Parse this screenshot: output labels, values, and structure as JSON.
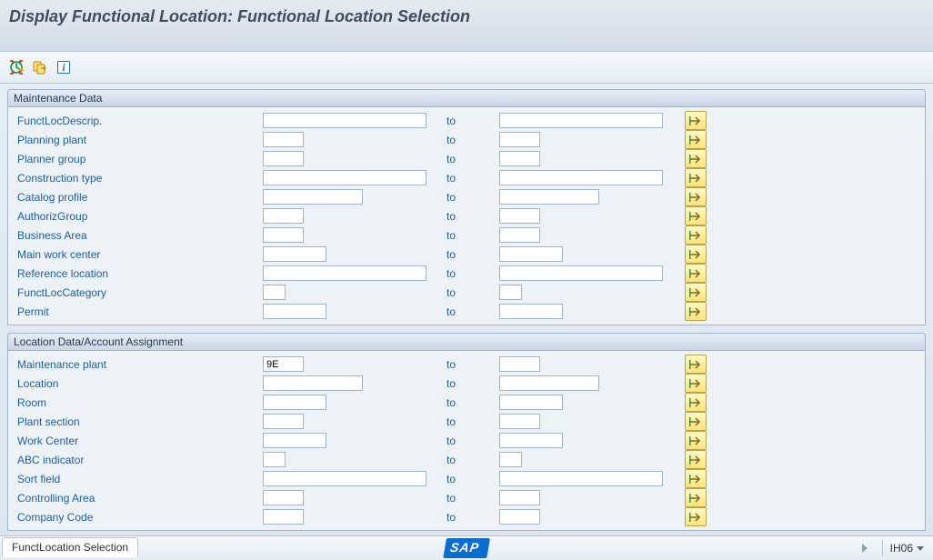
{
  "title": "Display Functional Location: Functional Location Selection",
  "toolbar": {
    "btn_execute_tooltip": "Execute selection",
    "btn_variant_tooltip": "Variant",
    "btn_info_tooltip": "Information"
  },
  "groups": {
    "maintenance": {
      "title": "Maintenance Data",
      "fields": [
        {
          "label": "FunctLocDescrip.",
          "to": "to",
          "size": "long"
        },
        {
          "label": "Planning plant",
          "to": "to",
          "size": "xs"
        },
        {
          "label": "Planner group",
          "to": "to",
          "size": "xs"
        },
        {
          "label": "Construction type",
          "to": "to",
          "size": "long"
        },
        {
          "label": "Catalog profile",
          "to": "to",
          "size": "med"
        },
        {
          "label": "AuthorizGroup",
          "to": "to",
          "size": "xs"
        },
        {
          "label": "Business Area",
          "to": "to",
          "size": "xs"
        },
        {
          "label": "Main work center",
          "to": "to",
          "size": "sm"
        },
        {
          "label": "Reference location",
          "to": "to",
          "size": "long"
        },
        {
          "label": "FunctLocCategory",
          "to": "to",
          "size": "xxs"
        },
        {
          "label": "Permit",
          "to": "to",
          "size": "sm"
        }
      ]
    },
    "location": {
      "title": "Location Data/Account Assignment",
      "fields": [
        {
          "label": "Maintenance plant",
          "to": "to",
          "size": "xs",
          "from_value": "9E"
        },
        {
          "label": "Location",
          "to": "to",
          "size": "med"
        },
        {
          "label": "Room",
          "to": "to",
          "size": "sm"
        },
        {
          "label": "Plant section",
          "to": "to",
          "size": "xs"
        },
        {
          "label": "Work Center",
          "to": "to",
          "size": "sm"
        },
        {
          "label": "ABC indicator",
          "to": "to",
          "size": "xxs"
        },
        {
          "label": "Sort field",
          "to": "to",
          "size": "long"
        },
        {
          "label": "Controlling Area",
          "to": "to",
          "size": "xs"
        },
        {
          "label": "Company Code",
          "to": "to",
          "size": "xs"
        }
      ]
    }
  },
  "status": {
    "tab": "FunctLocation Selection",
    "tcode": "IH06",
    "logo": "SAP"
  }
}
